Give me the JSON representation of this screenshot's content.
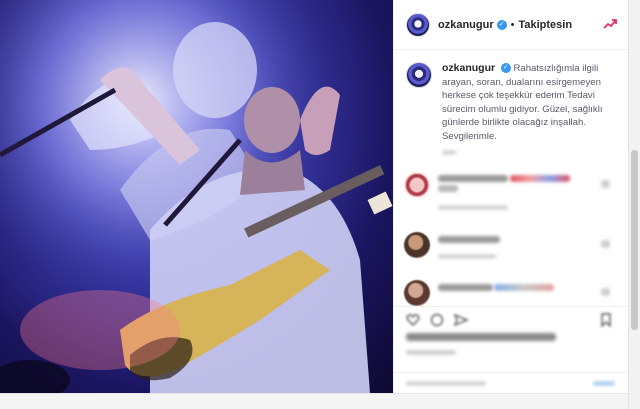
{
  "post": {
    "header": {
      "username": "ozkanugur",
      "separator": "•",
      "follow_status": "Takiptesin",
      "verified_icon": "verified-badge-icon",
      "trend_icon": "trend-up-icon"
    },
    "caption": {
      "username": "ozkanugur",
      "text": "Rahatsızlığımla ilgili arayan, soran, dualarını esirgemeyen herkese çok teşekkür ederim Tedavi sürecim olumlu gidiyor. Güzel, sağlıklı günlerde birlikte olacağız inşallah. Sevgilerimle."
    },
    "colors": {
      "accent": "#3897f0",
      "trend": "#e1306c",
      "photo_dark": "#1b1560",
      "photo_light": "#7b7be0"
    },
    "actions": [
      "heart-icon",
      "comment-icon",
      "share-icon",
      "bookmark-icon"
    ]
  }
}
